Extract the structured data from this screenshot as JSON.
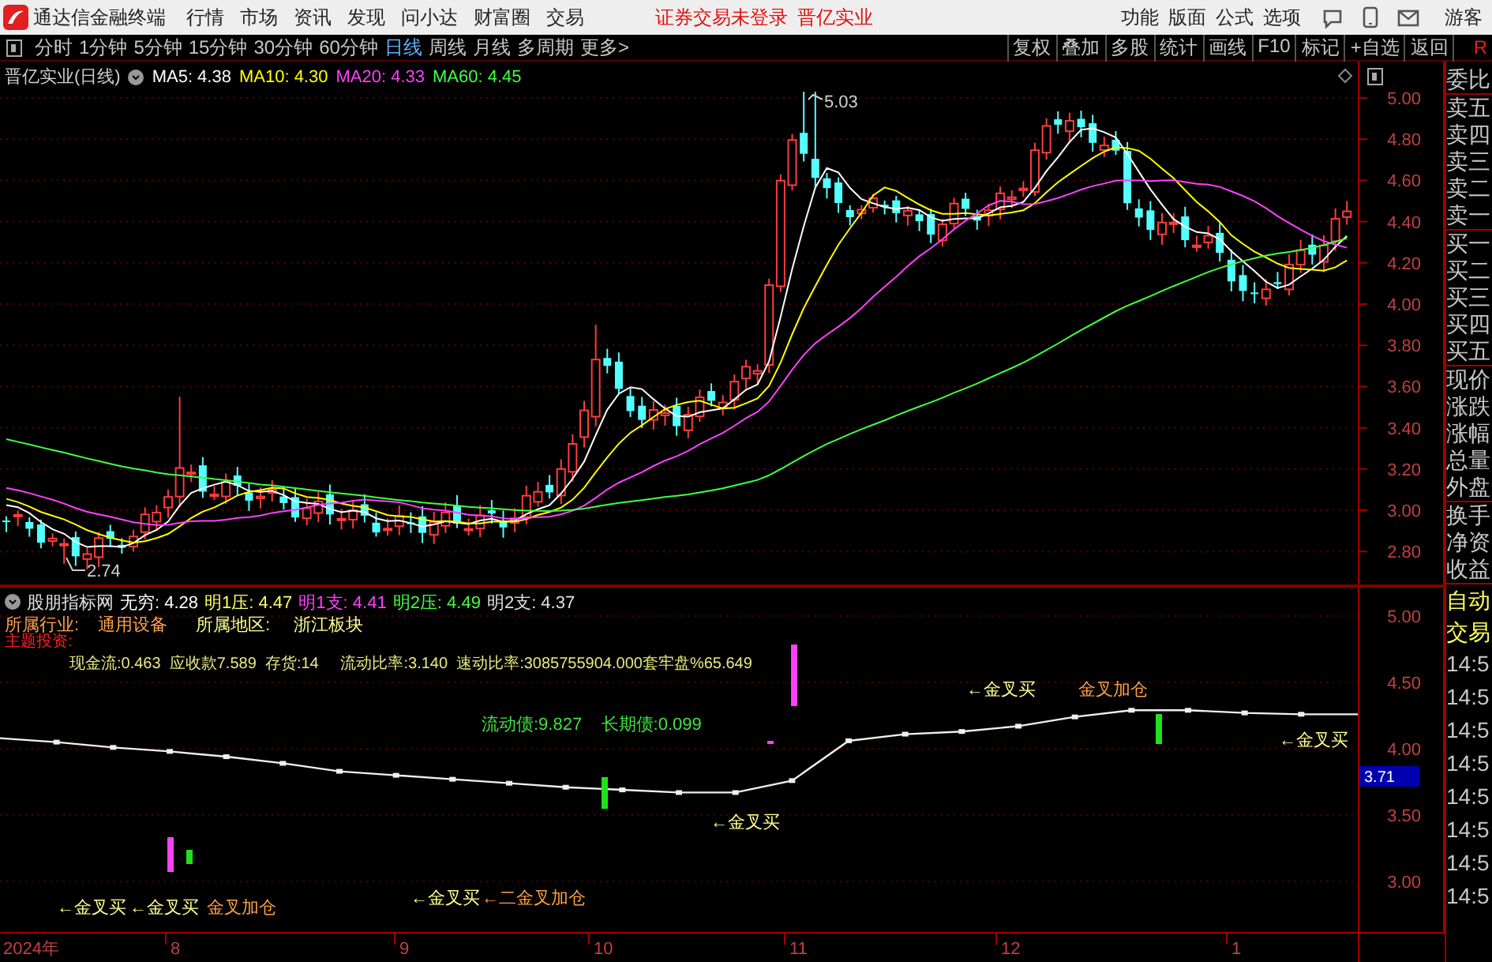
{
  "app": {
    "title": "通达信金融终端",
    "menu": [
      "行情",
      "市场",
      "资讯",
      "发现",
      "问小达",
      "财富圈",
      "交易"
    ],
    "notice": "证券交易未登录",
    "stock": "晋亿实业",
    "tools": [
      "功能",
      "版面",
      "公式",
      "选项"
    ],
    "user": "游客"
  },
  "periods": [
    {
      "label": "分时",
      "selected": false
    },
    {
      "label": "1分钟",
      "selected": false
    },
    {
      "label": "5分钟",
      "selected": false
    },
    {
      "label": "15分钟",
      "selected": false
    },
    {
      "label": "30分钟",
      "selected": false
    },
    {
      "label": "60分钟",
      "selected": false
    },
    {
      "label": "日线",
      "selected": true
    },
    {
      "label": "周线",
      "selected": false
    },
    {
      "label": "月线",
      "selected": false
    },
    {
      "label": "多周期",
      "selected": false
    },
    {
      "label": "更多>",
      "selected": false
    }
  ],
  "actions": [
    "复权",
    "叠加",
    "多股",
    "统计",
    "画线",
    "F10",
    "标记",
    "+自选",
    "返回"
  ],
  "corner_mark": "R",
  "price_chart": {
    "title": "晋亿实业(日线)",
    "ma": [
      {
        "label": "MA5: 4.38",
        "color": "#ffffff"
      },
      {
        "label": "MA10: 4.30",
        "color": "#ffff00"
      },
      {
        "label": "MA20: 4.33",
        "color": "#ff40ff"
      },
      {
        "label": "MA60: 4.45",
        "color": "#40ff40"
      }
    ],
    "high_label": "5.03",
    "low_label": "2.74",
    "yticks": [
      "5.00",
      "4.80",
      "4.60",
      "4.40",
      "4.20",
      "4.00",
      "3.80",
      "3.60",
      "3.40",
      "3.20",
      "3.00",
      "2.80"
    ]
  },
  "indicator": {
    "title": "股朋指标网",
    "readings": [
      {
        "label": "无穷: 4.28",
        "color": "#ffffff"
      },
      {
        "label": "明1压: 4.47",
        "color": "#ffff60"
      },
      {
        "label": "明1支: 4.41",
        "color": "#ff40ff"
      },
      {
        "label": "明2压: 4.49",
        "color": "#40ff40"
      },
      {
        "label": "明2支: 4.37",
        "color": "#e0e0e0"
      }
    ],
    "industry_label": "所属行业:",
    "industry": "通用设备",
    "region_label": "所属地区:",
    "region": "浙江板块",
    "theme_label": "主题投资:",
    "finance": "现金流:0.463  应收款7.589  存货:14     流动比率:3.140  速动比率:3085755904.000套牢盘%65.649",
    "debt": "流动债:9.827    长期债:0.099",
    "signals": [
      {
        "text": "←金叉买",
        "kind": "buy"
      },
      {
        "text": "金叉加仓",
        "kind": "add"
      },
      {
        "text": "←金叉买",
        "kind": "buy"
      },
      {
        "text": "←金叉买",
        "kind": "buy"
      },
      {
        "text": "←金叉买",
        "kind": "buy"
      },
      {
        "text": "←金叉买",
        "kind": "buy"
      },
      {
        "text": "金叉加仓",
        "kind": "add"
      },
      {
        "text": "←金叉买",
        "kind": "buy"
      },
      {
        "text": "←二金叉加仓",
        "kind": "add"
      }
    ],
    "current": "3.71",
    "chart_data": {
      "type": "line",
      "ylim": [
        3,
        5
      ],
      "grid": true,
      "yticks": [
        {
          "value": 5,
          "label": "5.00"
        },
        {
          "value": 4.5,
          "label": "4.50"
        },
        {
          "value": 4,
          "label": "4.00"
        },
        {
          "value": 3.5,
          "label": "3.50"
        },
        {
          "value": 3,
          "label": "3.00"
        }
      ],
      "series": [
        {
          "color": "#f0f0f0",
          "marker": "square",
          "values": [
            4.08,
            4.05,
            4.01,
            3.98,
            3.94,
            3.89,
            3.83,
            3.8,
            3.77,
            3.74,
            3.71,
            3.69,
            3.67,
            3.67,
            3.76,
            4.06,
            4.11,
            4.13,
            4.17,
            4.24,
            4.29,
            4.29,
            4.27,
            4.26,
            4.26
          ]
        }
      ]
    }
  },
  "date_axis": [
    "2024年",
    "8",
    "9",
    "10",
    "11",
    "12",
    "1"
  ],
  "quote_panel": {
    "groups": [
      [
        "委比"
      ],
      [
        "卖五",
        "卖四",
        "卖三",
        "卖二",
        "卖一"
      ],
      [
        "买一",
        "买二",
        "买三",
        "买四",
        "买五"
      ],
      [
        "现价",
        "涨跌",
        "涨幅",
        "总量",
        "外盘"
      ],
      [
        "换手",
        "净资",
        "收益"
      ]
    ],
    "auto_trade": [
      "自动",
      "交易"
    ],
    "times": [
      "14:5",
      "14:5",
      "14:5",
      "14:5",
      "14:5",
      "14:5",
      "14:5",
      "14:5"
    ]
  }
}
